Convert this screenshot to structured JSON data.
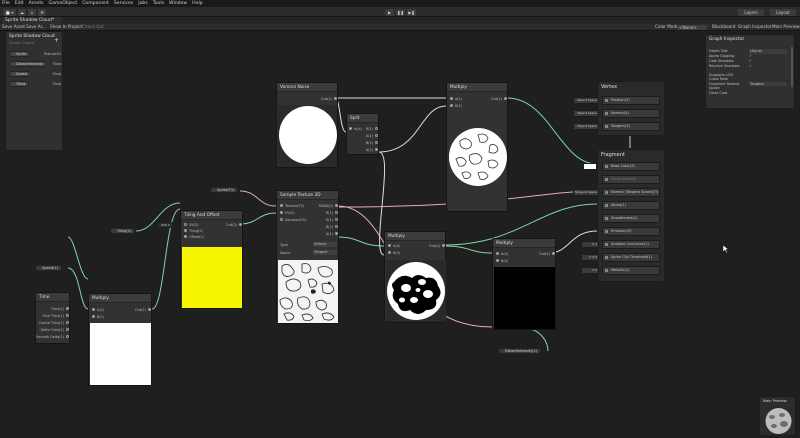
{
  "menu": [
    "File",
    "Edit",
    "Assets",
    "GameObject",
    "Component",
    "Services",
    "Jobs",
    "Tools",
    "Window",
    "Help"
  ],
  "toolbar": {
    "layers": "Layers",
    "layout": "Layout"
  },
  "tab": {
    "title": "Sprite Shadow Cloud*"
  },
  "sg_toolbar": {
    "save": "Save Asset",
    "save_as": "Save As...",
    "show_in_project": "Show In Project",
    "check_out": "Check Out",
    "color_mode_label": "Color Mode",
    "color_mode_value": "<None>",
    "blackboard": "Blackboard",
    "graph_inspector": "Graph Inspector",
    "main_preview": "Main Preview"
  },
  "blackboard": {
    "title": "Sprite Shadow Cloud",
    "subtitle": "Shader Graphs",
    "add": "+",
    "properties": [
      {
        "name": "Sprite",
        "type": "Texture2D"
      },
      {
        "name": "DistortIntensity",
        "type": "Float"
      },
      {
        "name": "Speed",
        "type": "Float"
      },
      {
        "name": "Tiling",
        "type": "Float"
      }
    ]
  },
  "graph_inspector": {
    "title": "Graph Inspector",
    "rows": [
      {
        "label": "Depth Test",
        "value": "LEqual"
      },
      {
        "label": "Alpha Clipping",
        "value": "✓"
      },
      {
        "label": "Cast Shadows",
        "value": "✓"
      },
      {
        "label": "Receive Shadows",
        "value": "✓"
      },
      {
        "label": "Supports LOD Cross Fade",
        "value": ""
      },
      {
        "label": "Fragment Normal Space",
        "value": "Tangent"
      },
      {
        "label": "Clear Coat",
        "value": ""
      }
    ]
  },
  "vertex": {
    "title": "Vertex",
    "slots": [
      {
        "side": "Object Space",
        "label": "Position(3)"
      },
      {
        "side": "Object Space",
        "label": "Normal(3)"
      },
      {
        "side": "Object Space",
        "label": "Tangent(3)"
      }
    ]
  },
  "fragment": {
    "title": "Fragment",
    "slots": [
      {
        "side": "",
        "label": "Base Color(3)"
      },
      {
        "side": "",
        "label": "Sprite Mask(4)"
      },
      {
        "side": "Tangent Space",
        "label": "Normal (Tangent Space)(3)"
      },
      {
        "side": "",
        "label": "Alpha(1)"
      },
      {
        "side": "X 0",
        "label": "Smoothness(1)"
      },
      {
        "side": "",
        "label": "Emission(3)"
      },
      {
        "side": "X 1",
        "label": "Ambient Occlusion(1)"
      },
      {
        "side": "X 0.5",
        "label": "Alpha Clip Threshold(1)"
      },
      {
        "side": "X 0",
        "label": "Metallic(1)"
      }
    ]
  },
  "nodes": {
    "time": {
      "title": "Time",
      "outputs": [
        "Time(1)",
        "Sine Time(1)",
        "Cosine Time(1)",
        "Delta Time(1)",
        "Smooth Delta(1)"
      ]
    },
    "multiply1": {
      "title": "Multiply",
      "inputs": [
        "A(1)",
        "B(1)"
      ],
      "output": "Out(1)"
    },
    "tiling": {
      "title": "Tiling And Offset",
      "inputs": [
        "UV(2)",
        "Tiling(2)",
        "Offset(2)"
      ],
      "output": "Out(2)",
      "uv_label": "UV0 ▾"
    },
    "sampler": {
      "title": "Sample Texture 2D",
      "inputs": [
        "Texture(T2)",
        "UV(2)",
        "Sampler(SS)"
      ],
      "outputs": [
        "RGBA(4)",
        "R(1)",
        "G(1)",
        "B(1)",
        "A(1)"
      ],
      "type_label": "Type",
      "type_value": "Default",
      "space_label": "Space",
      "space_value": "Tangent"
    },
    "voronoi": {
      "title": "Voronoi Noise",
      "output": "Out(1)"
    },
    "split": {
      "title": "Split",
      "input": "In(4)",
      "outputs": [
        "R(1)",
        "G(1)",
        "B(1)",
        "A(1)"
      ]
    },
    "multiply2": {
      "title": "Multiply",
      "inputs": [
        "A(4)",
        "B(4)"
      ],
      "output": "Out(4)"
    },
    "multiply3": {
      "title": "Multiply",
      "inputs": [
        "A(1)",
        "B(1)"
      ],
      "output": "Out(1)"
    },
    "multiply4": {
      "title": "Multiply",
      "inputs": [
        "A(4)",
        "B(4)"
      ],
      "output": "Out(4)"
    }
  },
  "pills": {
    "sprite": "Sprite(T2)",
    "tiling": "Tiling(1)",
    "speed": "Speed(1)",
    "distort": "DistortIntensity(1)"
  },
  "main_preview": {
    "title": "Main Preview"
  },
  "colors": {
    "canvas": "#1f1f1f",
    "node": "#323232",
    "wire_green": "#7fd6a2",
    "wire_pink": "#e6a9c6",
    "wire_white": "#dddddd",
    "yellow": "#f7f600"
  }
}
